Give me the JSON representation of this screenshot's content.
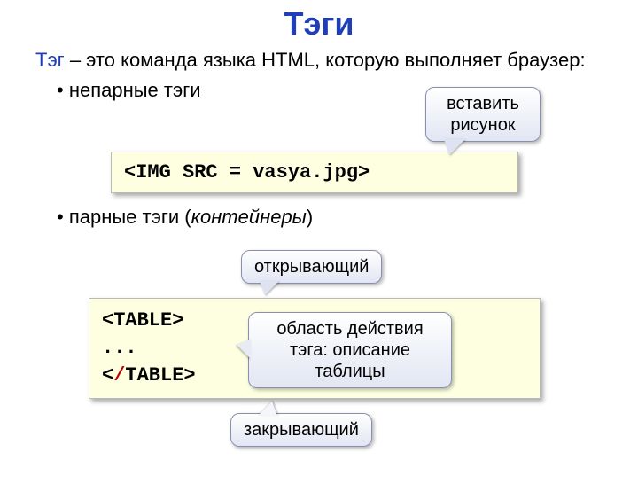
{
  "title": "Тэги",
  "definition": {
    "term": "Тэг",
    "rest": " – это команда языка HTML, которую выполняет браузер:"
  },
  "bullets": {
    "unpaired": "непарные тэги",
    "paired_prefix": "парные тэги (",
    "paired_italic": "контейнеры",
    "paired_suffix": ")"
  },
  "code1": "<IMG SRC = vasya.jpg>",
  "code2": {
    "open": "<TABLE>",
    "dots": "...",
    "close_pre": "<",
    "close_slash": "/",
    "close_post": "TABLE>"
  },
  "callouts": {
    "insert_l1": "вставить",
    "insert_l2": "рисунок",
    "open": "открывающий",
    "scope_l1": "область действия",
    "scope_l2": "тэга: описание",
    "scope_l3": "таблицы",
    "close": "закрывающий"
  }
}
